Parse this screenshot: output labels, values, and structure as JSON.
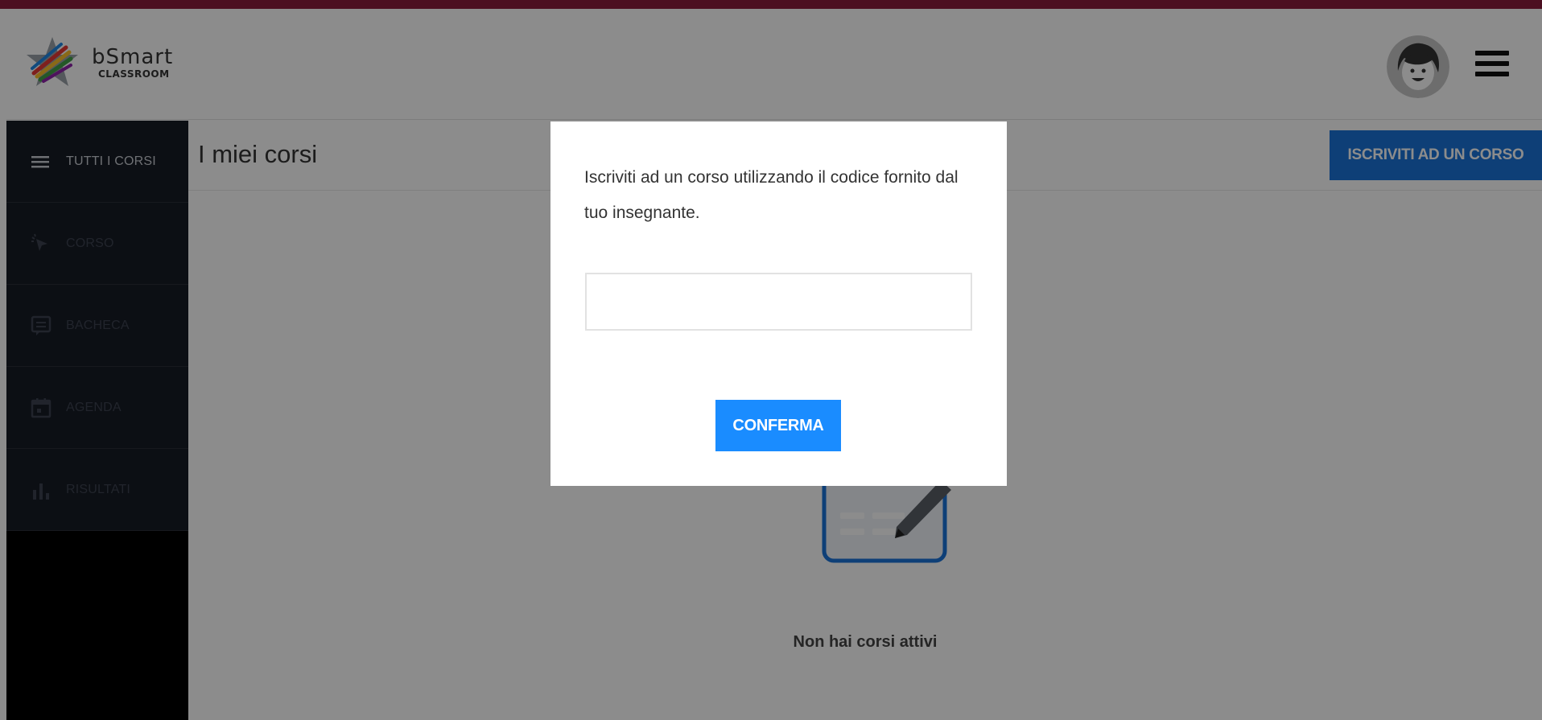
{
  "app": {
    "brand": "bSmart",
    "brand_sub": "CLASSROOM",
    "accent_color": "#8a1d3c",
    "primary_button_color": "#1a73d9"
  },
  "header": {
    "avatar_icon": "user-avatar-icon",
    "menu_icon": "hamburger-menu-icon"
  },
  "sidebar": {
    "items": [
      {
        "label": "TUTTI I CORSI",
        "icon": "list-icon"
      },
      {
        "label": "CORSO",
        "icon": "pointer-click-icon"
      },
      {
        "label": "BACHECA",
        "icon": "message-board-icon"
      },
      {
        "label": "AGENDA",
        "icon": "calendar-icon"
      },
      {
        "label": "RISULTATI",
        "icon": "bar-chart-icon"
      }
    ]
  },
  "main": {
    "title": "I miei corsi",
    "enroll_button": "ISCRIVITI AD UN CORSO",
    "empty_state_text": "Non hai corsi attivi",
    "empty_state_icon": "document-pencil-icon"
  },
  "modal": {
    "text": "Iscriviti ad un corso utilizzando il codice fornito dal tuo insegnante.",
    "input_value": "",
    "input_placeholder": "",
    "confirm_button": "CONFERMA"
  }
}
